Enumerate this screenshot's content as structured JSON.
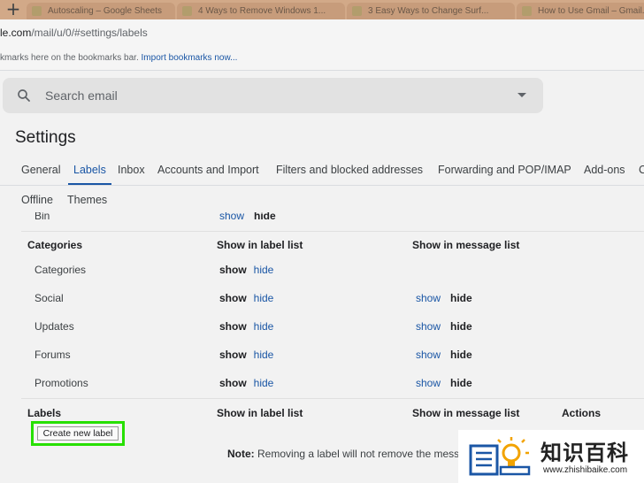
{
  "browser": {
    "new_tab_glyph": "+",
    "tabs": [
      {
        "label": "Autoscaling – Google Sheets"
      },
      {
        "label": "4 Ways to Remove Windows 1..."
      },
      {
        "label": "3 Easy Ways to Change Surf..."
      },
      {
        "label": "How to Use Gmail – Gmail..."
      }
    ],
    "address_host": "le.com",
    "address_path": "/mail/u/0/#settings/labels",
    "bookmarks_text": "kmarks here on the bookmarks bar.",
    "import_link": "Import bookmarks now..."
  },
  "search": {
    "placeholder": "Search email"
  },
  "page_title": "Settings",
  "tabs_row1": [
    "General",
    "Labels",
    "Inbox",
    "Accounts and Import",
    "Filters and blocked addresses",
    "Forwarding and POP/IMAP",
    "Add-ons",
    "C"
  ],
  "tabs_row2": [
    "Offline",
    "Themes"
  ],
  "bin_row": {
    "name": "Bin",
    "show": "show",
    "hide": "hide"
  },
  "categories_header": {
    "col_name": "Categories",
    "col_label_list": "Show in label list",
    "col_message_list": "Show in message list"
  },
  "category_rows": [
    {
      "name": "Categories",
      "label_show": "show",
      "label_hide": "hide",
      "msg_show": "",
      "msg_hide": ""
    },
    {
      "name": "Social",
      "label_show": "show",
      "label_hide": "hide",
      "msg_show": "show",
      "msg_hide": "hide"
    },
    {
      "name": "Updates",
      "label_show": "show",
      "label_hide": "hide",
      "msg_show": "show",
      "msg_hide": "hide"
    },
    {
      "name": "Forums",
      "label_show": "show",
      "label_hide": "hide",
      "msg_show": "show",
      "msg_hide": "hide"
    },
    {
      "name": "Promotions",
      "label_show": "show",
      "label_hide": "hide",
      "msg_show": "show",
      "msg_hide": "hide"
    }
  ],
  "labels_header": {
    "col_name": "Labels",
    "col_label_list": "Show in label list",
    "col_message_list": "Show in message list",
    "col_actions": "Actions"
  },
  "create_label_button": "Create new label",
  "note": {
    "prefix": "Note:",
    "text": "Removing a label will not remove the mess"
  },
  "watermark": {
    "title": "知识百科",
    "url": "www.zhishibaike.com"
  },
  "colors": {
    "link": "#1a56a5",
    "highlight": "#27e000",
    "tabbar": "#d2a988"
  }
}
